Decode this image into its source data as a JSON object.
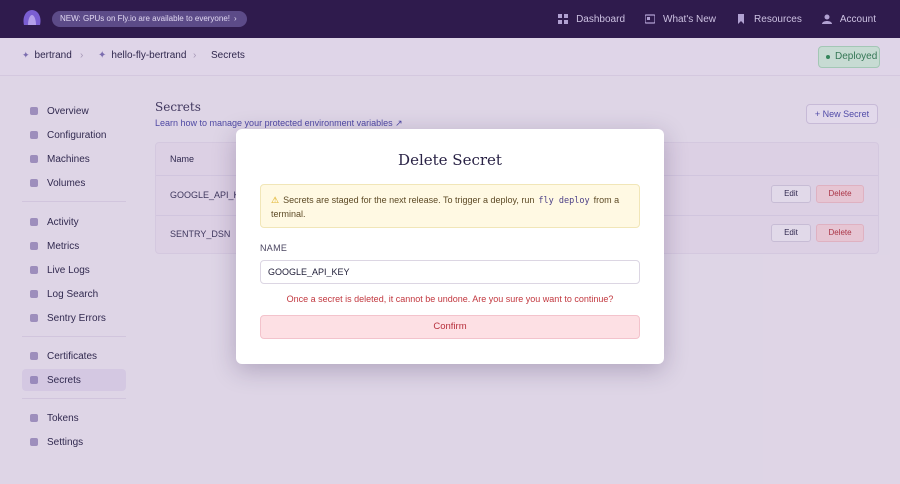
{
  "topnav": {
    "announcement": "NEW: GPUs on Fly.io are available to everyone!",
    "links": [
      {
        "label": "Dashboard",
        "icon": "dashboard-icon"
      },
      {
        "label": "What's New",
        "icon": "news-icon"
      },
      {
        "label": "Resources",
        "icon": "bookmark-icon"
      },
      {
        "label": "Account",
        "icon": "user-icon"
      }
    ]
  },
  "breadcrumb": {
    "org": "bertrand",
    "app": "hello-fly-bertrand",
    "page": "Secrets"
  },
  "status": {
    "label": "Deployed",
    "color": "#2f7a4f"
  },
  "sidebar": {
    "items": [
      {
        "label": "Overview"
      },
      {
        "label": "Configuration"
      },
      {
        "label": "Machines"
      },
      {
        "label": "Volumes"
      },
      {
        "label": "Activity"
      },
      {
        "label": "Metrics"
      },
      {
        "label": "Live Logs"
      },
      {
        "label": "Log Search"
      },
      {
        "label": "Sentry Errors"
      },
      {
        "label": "Certificates"
      },
      {
        "label": "Secrets"
      },
      {
        "label": "Tokens"
      },
      {
        "label": "Settings"
      }
    ]
  },
  "main": {
    "title": "Secrets",
    "link": "Learn how to manage your protected environment variables ↗",
    "new_button": "+ New Secret",
    "table": {
      "header": "Name",
      "rows": [
        {
          "name": "GOOGLE_API_KEY",
          "edit": "Edit",
          "delete": "Delete"
        },
        {
          "name": "SENTRY_DSN",
          "edit": "Edit",
          "delete": "Delete"
        }
      ]
    }
  },
  "modal": {
    "title": "Delete Secret",
    "warning_prefix": "Secrets are staged for the next release. To trigger a deploy, run",
    "warning_code": "fly deploy",
    "warning_suffix": "from a terminal.",
    "field_label": "NAME",
    "field_value": "GOOGLE_API_KEY",
    "confirm_text": "Once a secret is deleted, it cannot be undone. Are you sure you want to continue?",
    "confirm_button": "Confirm"
  },
  "colors": {
    "nav_bg": "#2a1646",
    "danger": "#c2383f",
    "accent": "#4b47a3"
  }
}
